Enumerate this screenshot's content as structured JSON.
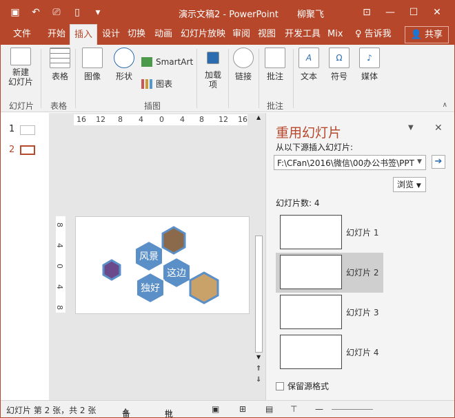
{
  "titlebar": {
    "doc_title": "演示文稿2 - PowerPoint",
    "user": "柳聚飞"
  },
  "tabs": [
    "文件",
    "开始",
    "插入",
    "设计",
    "切换",
    "动画",
    "幻灯片放映",
    "审阅",
    "视图",
    "开发工具",
    "Mix",
    "告诉我",
    "共享"
  ],
  "ribbon": {
    "new_slide": "新建\n幻灯片",
    "table": "表格",
    "image": "图像",
    "shapes": "形状",
    "smartart": "SmartArt",
    "chart": "图表",
    "addins": "加载\n项",
    "link": "链接",
    "comment": "批注",
    "text": "文本",
    "symbol": "符号",
    "media": "媒体",
    "groups": {
      "slides": "幻灯片",
      "tables": "表格",
      "illus": "插图",
      "comments": "批注"
    }
  },
  "thumbs": [
    "1",
    "2"
  ],
  "ruler": {
    "h": [
      "16",
      "12",
      "8",
      "4",
      "0",
      "4",
      "8",
      "12",
      "16"
    ],
    "v": [
      "8",
      "4",
      "0",
      "4",
      "8"
    ]
  },
  "slide": {
    "texts": [
      "风景",
      "这边",
      "独好"
    ]
  },
  "pane": {
    "title": "重用幻灯片",
    "insert_label": "从以下源插入幻灯片:",
    "path": "F:\\CFan\\2016\\微信\\00办公书签\\PPT",
    "browse": "浏览",
    "count": "幻灯片数: 4",
    "slides": [
      "幻灯片 1",
      "幻灯片 2",
      "幻灯片 3",
      "幻灯片 4"
    ],
    "keep": "保留源格式"
  },
  "status": {
    "slide_info": "幻灯片 第 2 张，共 2 张",
    "notes": "备注",
    "comments": "批注"
  },
  "colors": {
    "accent": "#b7472a",
    "hex_fill": "#5b8fc7"
  }
}
